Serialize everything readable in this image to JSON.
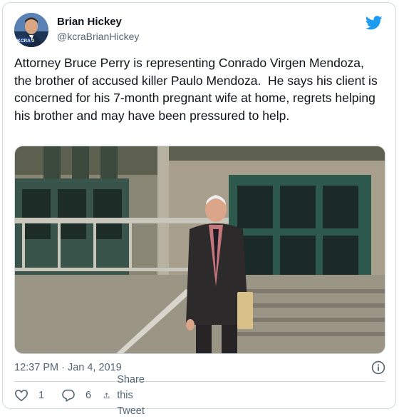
{
  "author": {
    "display_name": "Brian Hickey",
    "handle": "@kcraBrianHickey",
    "avatar_badge": "KCRA 3"
  },
  "tweet": {
    "text": "Attorney Bruce Perry is representing Conrado Virgen Mendoza, the brother of accused killer Paulo Mendoza.  He says his client is concerned for his 7-month pregnant wife at home, regrets helping his brother and may have been pressured to help."
  },
  "meta": {
    "timestamp": "12:37 PM · Jan 4, 2019"
  },
  "actions": {
    "like_count": "1",
    "reply_count": "6",
    "share_label": "Share this Tweet"
  },
  "icons": {
    "brand": "twitter-bird-icon",
    "info": "info-icon",
    "like": "heart-icon",
    "reply": "comment-bubble-icon",
    "share": "share-upload-icon"
  },
  "colors": {
    "twitter_blue": "#1d9bf0",
    "text_primary": "#0f1419",
    "text_secondary": "#536471",
    "border": "#cfd9de"
  }
}
